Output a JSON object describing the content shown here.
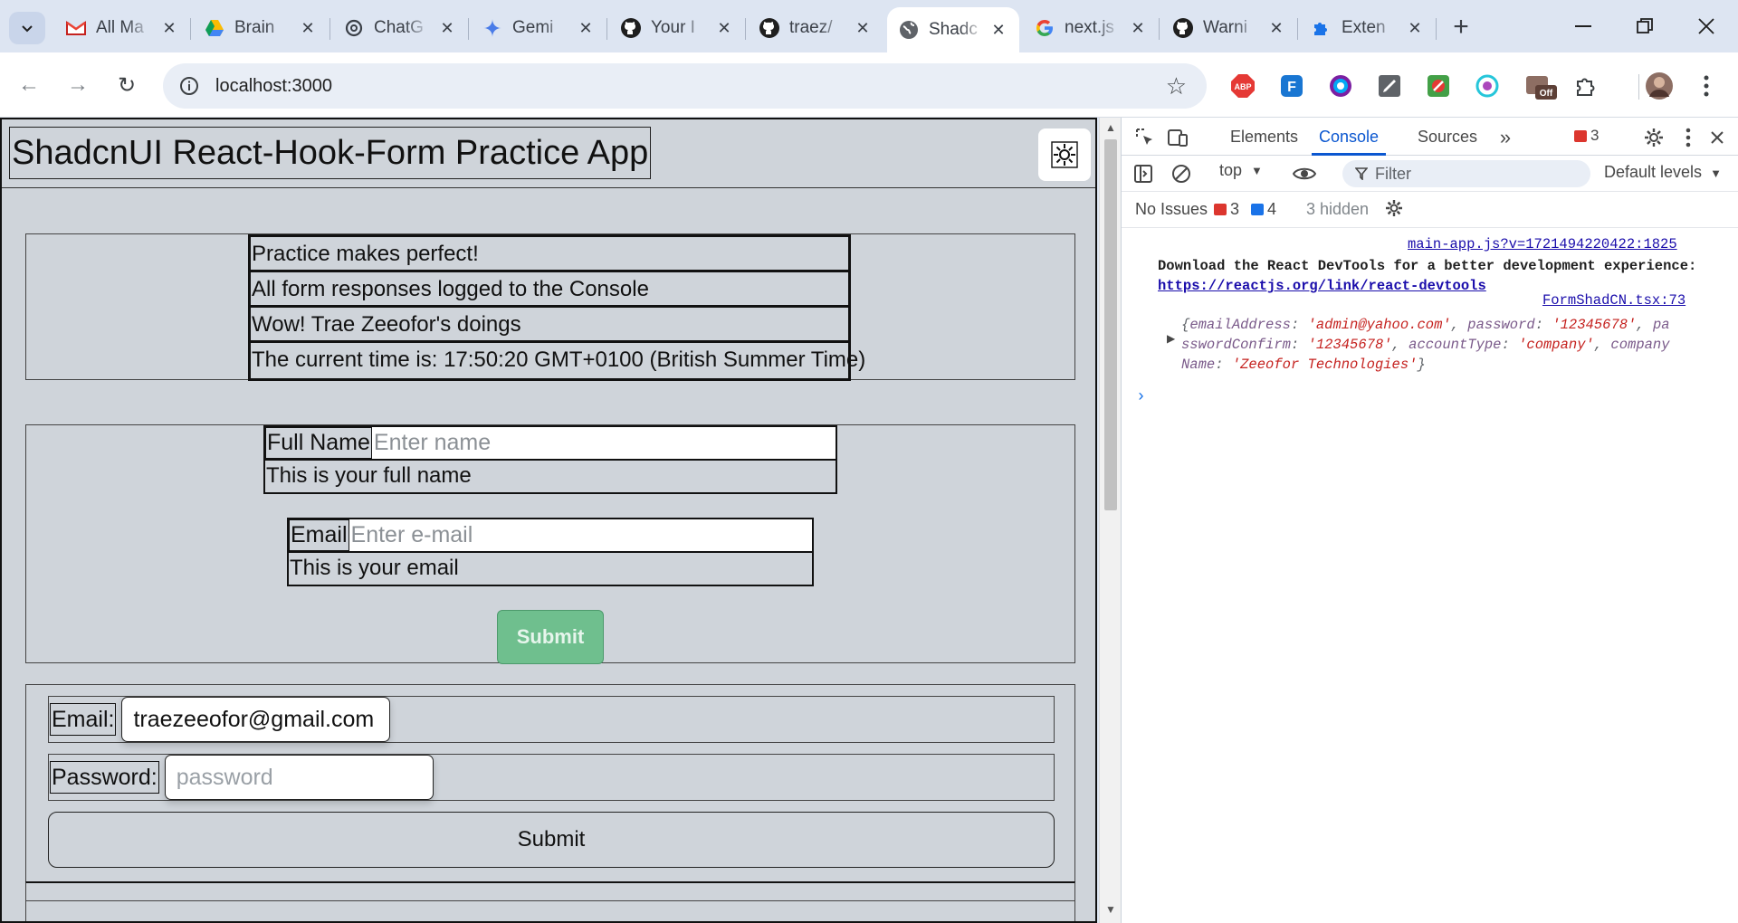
{
  "browser": {
    "tabs": [
      {
        "label": "All Ma",
        "icon": "gmail-icon"
      },
      {
        "label": "Brain",
        "icon": "google-drive-icon"
      },
      {
        "label": "ChatG",
        "icon": "chatgpt-icon"
      },
      {
        "label": "Gemi",
        "icon": "gemini-icon"
      },
      {
        "label": "Your I",
        "icon": "github-icon"
      },
      {
        "label": "traez/",
        "icon": "github-icon"
      },
      {
        "label": "Shadc",
        "icon": "globe-icon",
        "active": true
      },
      {
        "label": "next.js",
        "icon": "google-icon"
      },
      {
        "label": "Warni",
        "icon": "github-icon"
      },
      {
        "label": "Exten",
        "icon": "extension-icon"
      }
    ],
    "url": "localhost:3000",
    "extensions": [
      "adblock-plus-icon",
      "extension-f-icon",
      "color-picker-icon",
      "pen-icon",
      "no-icon",
      "circle-ext-icon",
      "off-toggle-icon",
      "puzzle-icon"
    ],
    "off_badge": "Off"
  },
  "page": {
    "title": "ShadcnUI React-Hook-Form Practice App",
    "info_rows": [
      "Practice makes perfect!",
      "All form responses logged to the Console",
      "Wow! Trae Zeeofor's doings",
      "The current time is: 17:50:20 GMT+0100 (British Summer Time)"
    ],
    "form1": {
      "name_label": "Full Name",
      "name_placeholder": "Enter name",
      "name_desc": "This is your full name",
      "email_label": "Email",
      "email_placeholder": "Enter e-mail",
      "email_desc": "This is your email",
      "submit": "Submit"
    },
    "form2": {
      "email_label": "Email:",
      "email_value": "traezeeofor@gmail.com",
      "password_label": "Password:",
      "password_placeholder": "password",
      "submit": "Submit"
    }
  },
  "devtools": {
    "tabs": [
      "Elements",
      "Console",
      "Sources"
    ],
    "active_tab": "Console",
    "error_count": "3",
    "context": "top",
    "filter_placeholder": "Filter",
    "levels": "Default levels",
    "issues_label": "No Issues",
    "issue_errors": "3",
    "issue_messages": "4",
    "hidden": "3 hidden",
    "logs": [
      {
        "source": "main-app.js?v=1721494220422:1825",
        "text": "Download the React DevTools for a better development experience: ",
        "link": "https://reactjs.org/link/react-devtools"
      },
      {
        "source": "FormShadCN.tsx:73"
      }
    ],
    "object_log": {
      "line1_open": "{",
      "k1": "emailAddress",
      "v1": "'admin@yahoo.com'",
      "k2": "password",
      "v2": "'12345678'",
      "k3a": "pa",
      "k3b": "sswordConfirm",
      "v3": "'12345678'",
      "k4": "accountType",
      "v4": "'company'",
      "k5a": "company",
      "k5b": "Name",
      "v5": "'Zeeofor Technologies'",
      "close": "}"
    }
  },
  "colors": {
    "accent": "#0b57d0",
    "page_bg": "#cfd4da",
    "submit_green": "#6fbf8e",
    "error_red": "#dc362e"
  }
}
